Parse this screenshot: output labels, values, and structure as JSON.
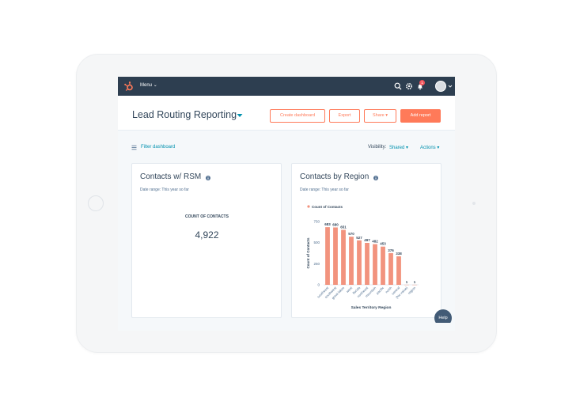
{
  "nav": {
    "menu_label": "Menu",
    "notification_count": "1",
    "icons": [
      "hubspot-sprocket-icon",
      "search-icon",
      "settings-icon",
      "bell-icon"
    ]
  },
  "header": {
    "title": "Lead Routing Reporting",
    "buttons": {
      "create_dashboard": "Create dashboard",
      "export": "Export",
      "share": "Share",
      "add_report": "Add report"
    }
  },
  "toolbar": {
    "filter_label": "Filter dashboard",
    "visibility_label": "Visibility:",
    "visibility_value": "Shared",
    "actions_label": "Actions"
  },
  "cards": {
    "contacts_rsm": {
      "title": "Contacts w/ RSM",
      "date_range": "Date range: This year so far",
      "kpi_label": "COUNT OF CONTACTS",
      "kpi_value": "4,922"
    },
    "contacts_region": {
      "title": "Contacts by Region",
      "date_range": "Date range: This year so far"
    }
  },
  "help_label": "Help",
  "colors": {
    "nav_bg": "#2d3e50",
    "accent": "#ff7a59",
    "bar": "#f2937e",
    "link": "#0091ae",
    "text": "#33475b"
  },
  "chart_data": {
    "type": "bar",
    "legend": "Count of Contacts",
    "ylabel": "Count of Contacts",
    "xlabel": "Sales Territory Region",
    "ylim": [
      0,
      750
    ],
    "yticks": [
      0,
      250,
      500,
      750
    ],
    "categories": [
      "southeast",
      "southwest",
      "great lakes",
      "west",
      "florida",
      "northeast",
      "mountain",
      "pacific",
      "north",
      "central",
      "(No value)",
      "region"
    ],
    "values": [
      683,
      680,
      651,
      570,
      527,
      497,
      482,
      453,
      376,
      338,
      1,
      1
    ],
    "value_labels": [
      "683",
      "680",
      "651",
      "570",
      "527",
      "497",
      "482",
      "453",
      "376",
      "338",
      "1",
      "1"
    ]
  }
}
